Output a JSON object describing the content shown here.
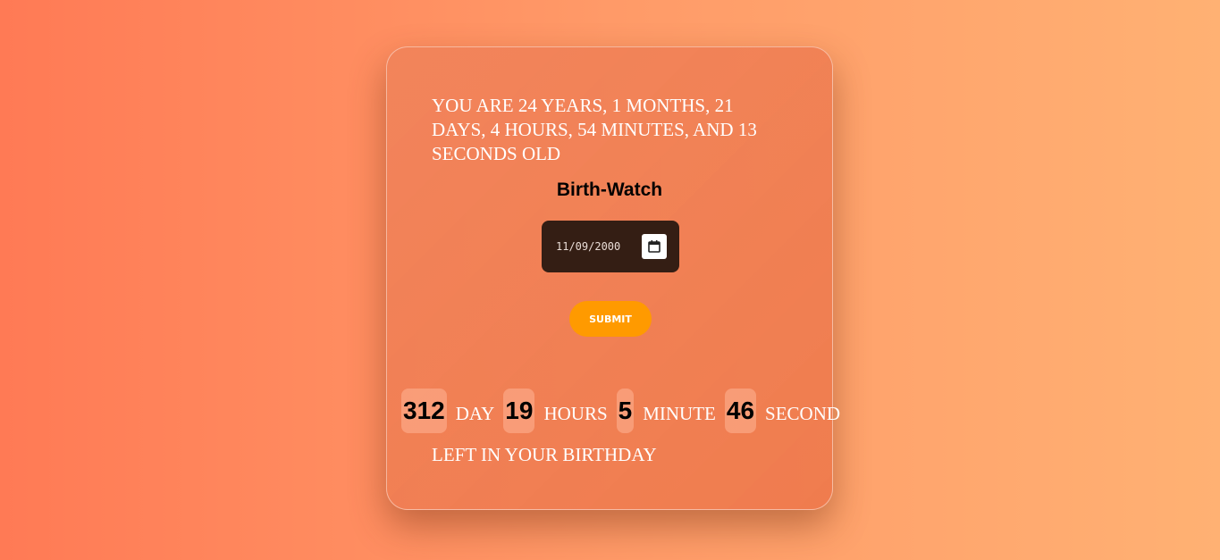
{
  "age_message": "YOU ARE 24 YEARS, 1 MONTHS, 21 DAYS, 4 HOURS, 54 MINUTES, AND 13 SECONDS OLD",
  "app": {
    "title": "Birth-Watch"
  },
  "birth_date_input": {
    "value": "11/09/2000"
  },
  "submit": {
    "label": "SUBMIT"
  },
  "countdown": {
    "days": {
      "value": "312",
      "label": "DAY"
    },
    "hours": {
      "value": "19",
      "label": "HOURS"
    },
    "minutes": {
      "value": "5",
      "label": "MINUTE"
    },
    "seconds": {
      "value": "46",
      "label": "SECOND"
    },
    "footer": "LEFT IN YOUR BIRTHDAY"
  },
  "icons": {
    "calendar": "calendar-icon"
  },
  "colors": {
    "background_start": "#ff7a55",
    "background_end": "#ffb173",
    "input_bg": "#341e14",
    "submit_bg": "#ff9a00"
  }
}
